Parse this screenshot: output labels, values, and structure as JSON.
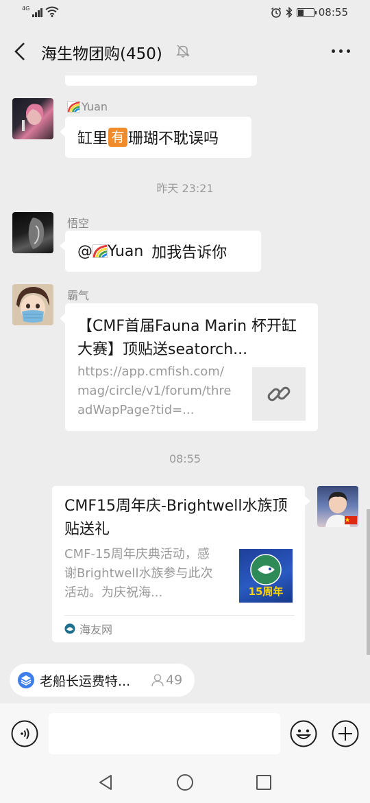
{
  "status_bar": {
    "network": "4G",
    "time": "08:55",
    "battery_level": 0.35
  },
  "header": {
    "title": "海生物团购(450)",
    "icons": [
      "back-arrow-icon",
      "mute-bell-icon",
      "more-icon"
    ]
  },
  "messages": [
    {
      "type": "text",
      "sender": "Yuan",
      "text_before": "缸里",
      "badge": "有",
      "text_after": "珊瑚不耽误吗"
    },
    {
      "type": "timestamp",
      "text": "昨天 23:21"
    },
    {
      "type": "text",
      "sender": "悟空",
      "mention": "@",
      "mention_name": "Yuan",
      "text_after": "加我告诉你"
    },
    {
      "type": "link",
      "sender": "霸气",
      "title": "【CMF首届Fauna Marin 杯开缸大赛】顶贴送seatorch...",
      "url": "https://app.cmfish.com/mag/circle/v1/forum/threadWapPage?tid=...",
      "thumb_icon": "link-icon"
    },
    {
      "type": "timestamp",
      "text": "08:55"
    },
    {
      "type": "article",
      "sender": "me",
      "title": "CMF15周年庆-Brightwell水族顶贴送礼",
      "desc": "CMF-15周年庆典活动，感谢Brightwell水族参与此次活动。为庆祝海...",
      "thumb_caption": "15周年",
      "source": "海友网"
    }
  ],
  "pinned": {
    "label": "老船长运费特...",
    "count": "49"
  },
  "input": {
    "placeholder": ""
  },
  "colors": {
    "background": "#ededed",
    "bubble": "#ffffff",
    "badge": "#f08c2c"
  }
}
